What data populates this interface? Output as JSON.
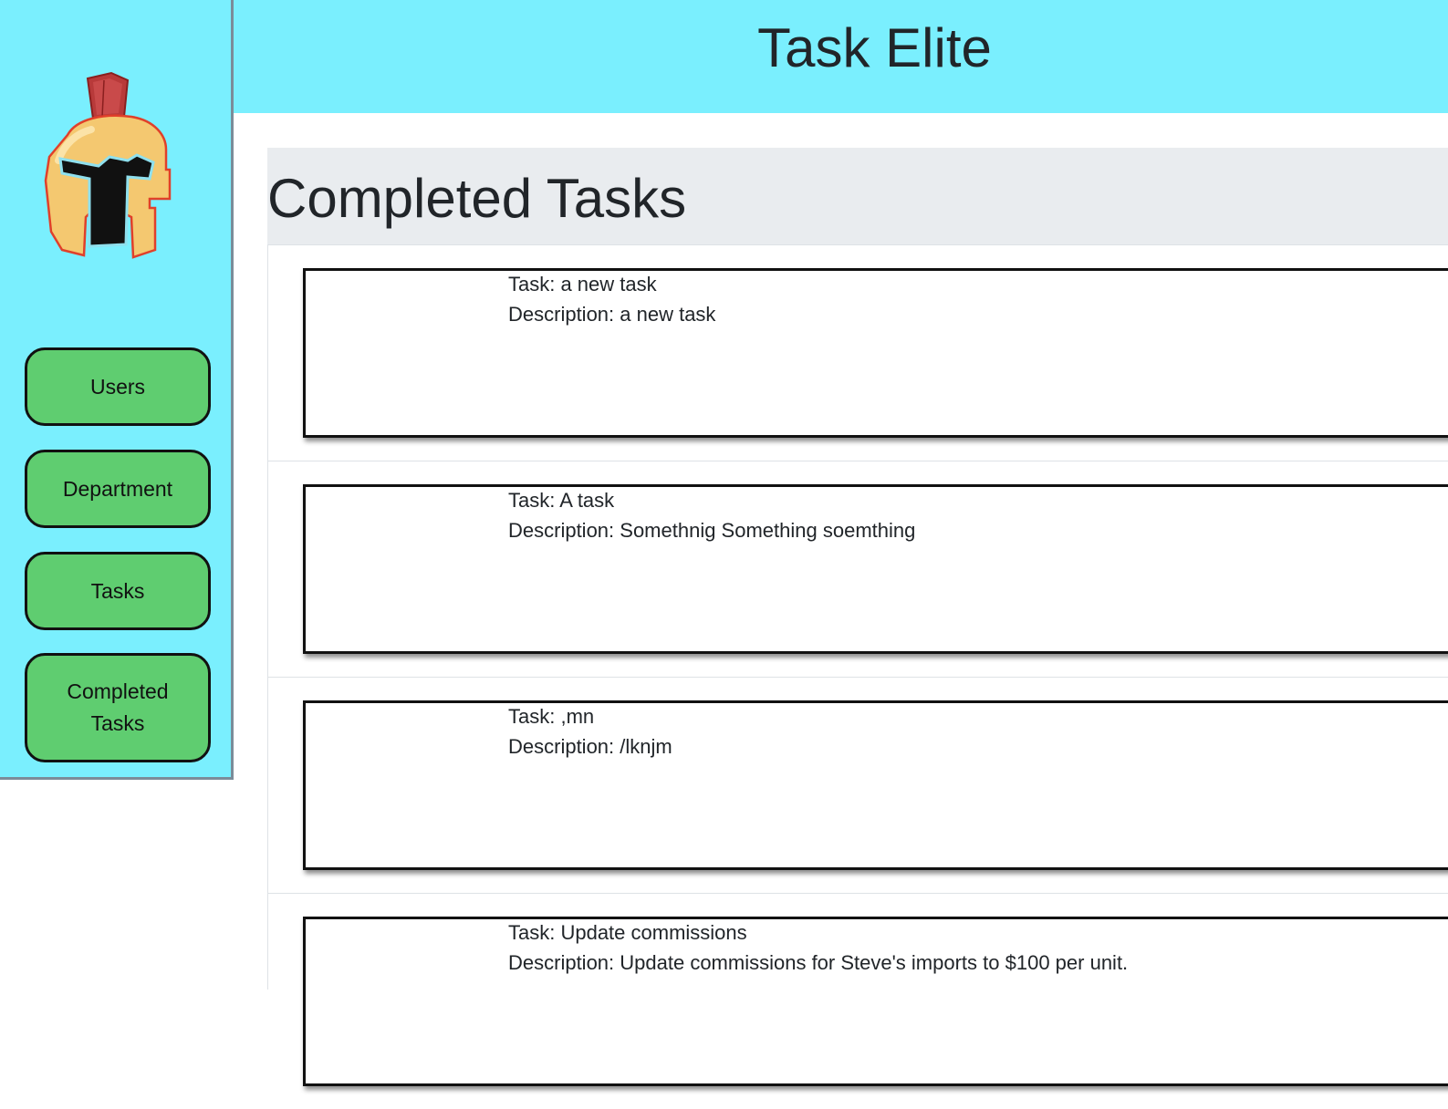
{
  "header": {
    "title": "Task Elite"
  },
  "sidebar": {
    "logo": "spartan-helmet-logo",
    "items": [
      {
        "label": "Users"
      },
      {
        "label": "Department"
      },
      {
        "label": "Tasks"
      },
      {
        "label": "Completed Tasks"
      }
    ]
  },
  "main": {
    "heading": "Completed Tasks",
    "tasks": [
      {
        "task": "Task: a new task",
        "description": "Description: a new task"
      },
      {
        "task": "Task: A task",
        "description": "Description: Somethnig Something soemthing"
      },
      {
        "task": "Task: ,mn",
        "description": "Description: /lknjm"
      },
      {
        "task": "Task: Update commissions",
        "description": "Description: Update commissions for Steve's imports to $100 per unit."
      }
    ]
  },
  "colors": {
    "accent": "#7aeffe",
    "nav_button": "#5fcd70",
    "jumbotron": "#e9ecef"
  }
}
